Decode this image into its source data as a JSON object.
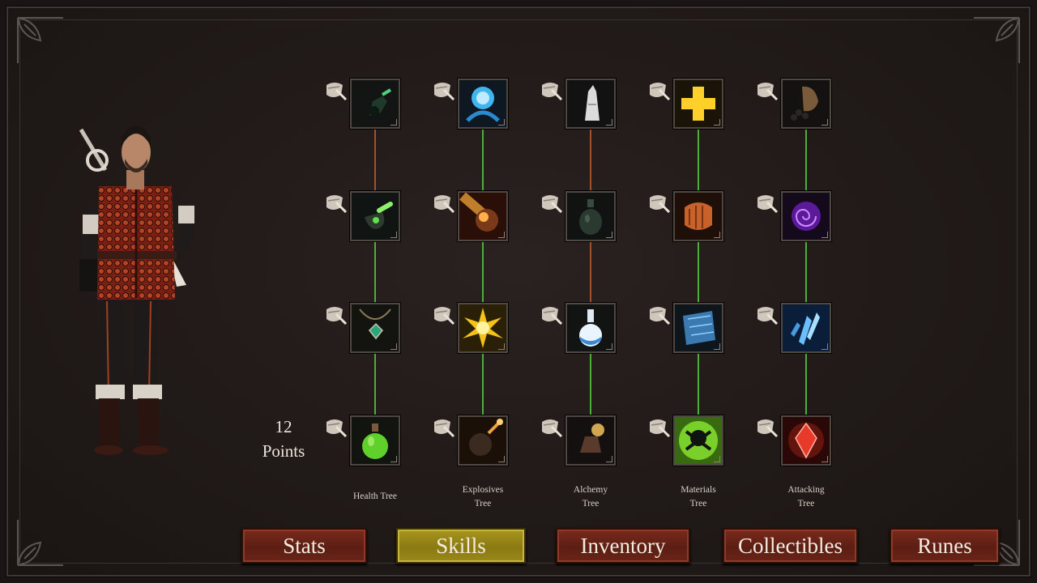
{
  "character": {
    "skill_points_value": "12",
    "skill_points_label": "Points"
  },
  "colors": {
    "connector_active": "#4caf3a",
    "connector_inactive": "#a0522d",
    "button_red": "#6a2417",
    "button_active_gold": "#9a881a"
  },
  "trees": [
    {
      "label": "Health Tree",
      "skills": [
        {
          "icon": "flask-icon"
        },
        {
          "icon": "potion-bag-icon"
        },
        {
          "icon": "amulet-icon"
        },
        {
          "icon": "green-potion-icon"
        }
      ],
      "connectors": [
        "inactive",
        "active",
        "active"
      ]
    },
    {
      "label": "Explosives\nTree",
      "skills": [
        {
          "icon": "blue-orb-icon"
        },
        {
          "icon": "meteor-icon"
        },
        {
          "icon": "explosion-burst-icon"
        },
        {
          "icon": "bomb-icon"
        }
      ],
      "connectors": [
        "active",
        "active",
        "active"
      ]
    },
    {
      "label": "Alchemy\nTree",
      "skills": [
        {
          "icon": "white-vial-icon"
        },
        {
          "icon": "dark-flask-icon"
        },
        {
          "icon": "round-flask-icon"
        },
        {
          "icon": "burning-bag-icon"
        }
      ],
      "connectors": [
        "inactive",
        "inactive",
        "active"
      ]
    },
    {
      "label": "Materials\nTree",
      "skills": [
        {
          "icon": "cross-plus-icon"
        },
        {
          "icon": "leather-scroll-icon"
        },
        {
          "icon": "blue-plate-icon"
        },
        {
          "icon": "poison-skull-icon"
        }
      ],
      "connectors": [
        "active",
        "active",
        "active"
      ]
    },
    {
      "label": "Attacking\nTree",
      "skills": [
        {
          "icon": "coin-sack-icon"
        },
        {
          "icon": "purple-vortex-icon"
        },
        {
          "icon": "ice-shards-icon"
        },
        {
          "icon": "red-crystal-icon"
        }
      ],
      "connectors": [
        "active",
        "active",
        "active"
      ]
    }
  ],
  "nav": {
    "stats": "Stats",
    "skills": "Skills",
    "inventory": "Inventory",
    "collectibles": "Collectibles",
    "runes": "Runes",
    "active": "skills"
  }
}
